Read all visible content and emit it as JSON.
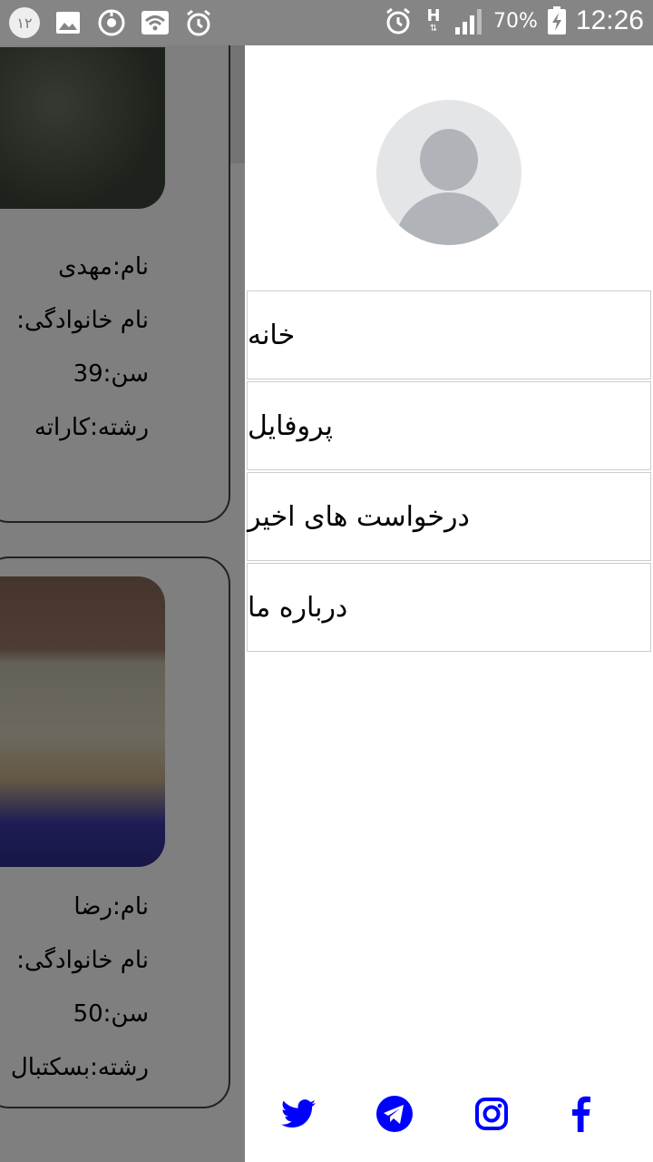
{
  "status_bar": {
    "notification_count": "۱۲",
    "battery": "70%",
    "time": "12:26",
    "network_type": "H"
  },
  "cards": [
    {
      "name": "نام:مهدی",
      "family": "نام خانوادگی:",
      "age": "سن:39",
      "field": "رشته:کاراته"
    },
    {
      "name": "نام:رضا",
      "family": "نام خانوادگی:",
      "age": "سن:50",
      "field": "رشته:بسکتبال"
    }
  ],
  "drawer": {
    "menu": [
      {
        "label": "خانه"
      },
      {
        "label": "پروفایل"
      },
      {
        "label": "درخواست های اخیر"
      },
      {
        "label": "درباره ما"
      }
    ],
    "social_icons": [
      "twitter-icon",
      "telegram-icon",
      "instagram-icon",
      "facebook-icon"
    ]
  },
  "colors": {
    "accent": "#00008b",
    "social": "#0000ff",
    "scrim": "#7f7f7f"
  }
}
